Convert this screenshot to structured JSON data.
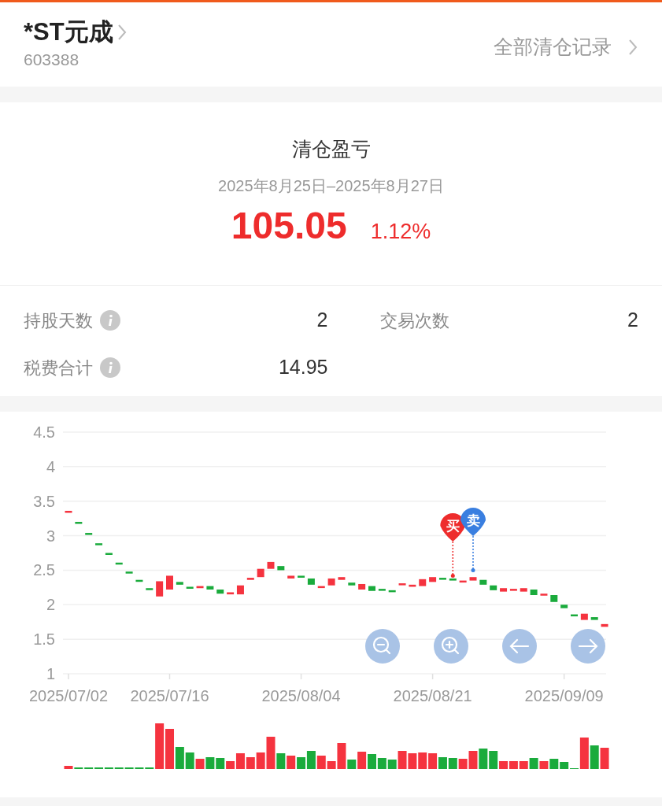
{
  "header": {
    "name": "*ST元成",
    "code": "603388",
    "all_records_link": "全部清仓记录"
  },
  "summary": {
    "title": "清仓盈亏",
    "period": "2025年8月25日–2025年8月27日",
    "profit": "105.05",
    "percent": "1.12%"
  },
  "stats": [
    {
      "label": "持股天数",
      "info": true,
      "value": "2"
    },
    {
      "label": "交易次数",
      "info": false,
      "value": "2"
    },
    {
      "label": "税费合计",
      "info": true,
      "value": "14.95"
    }
  ],
  "chart": {
    "y_axis_labels": [
      "4.5",
      "4",
      "3.5",
      "3",
      "2.5",
      "2",
      "1.5",
      "1"
    ],
    "x_axis_labels": [
      "2025/07/02",
      "2025/07/16",
      "2025/08/04",
      "2025/08/21",
      "2025/09/09"
    ],
    "markers": [
      {
        "label": "买",
        "color": "#ee2c2c"
      },
      {
        "label": "卖",
        "color": "#3a7fe0"
      }
    ],
    "controls": [
      {
        "kind": "zoom-out"
      },
      {
        "kind": "zoom-in"
      },
      {
        "kind": "left"
      },
      {
        "kind": "right"
      }
    ]
  }
}
